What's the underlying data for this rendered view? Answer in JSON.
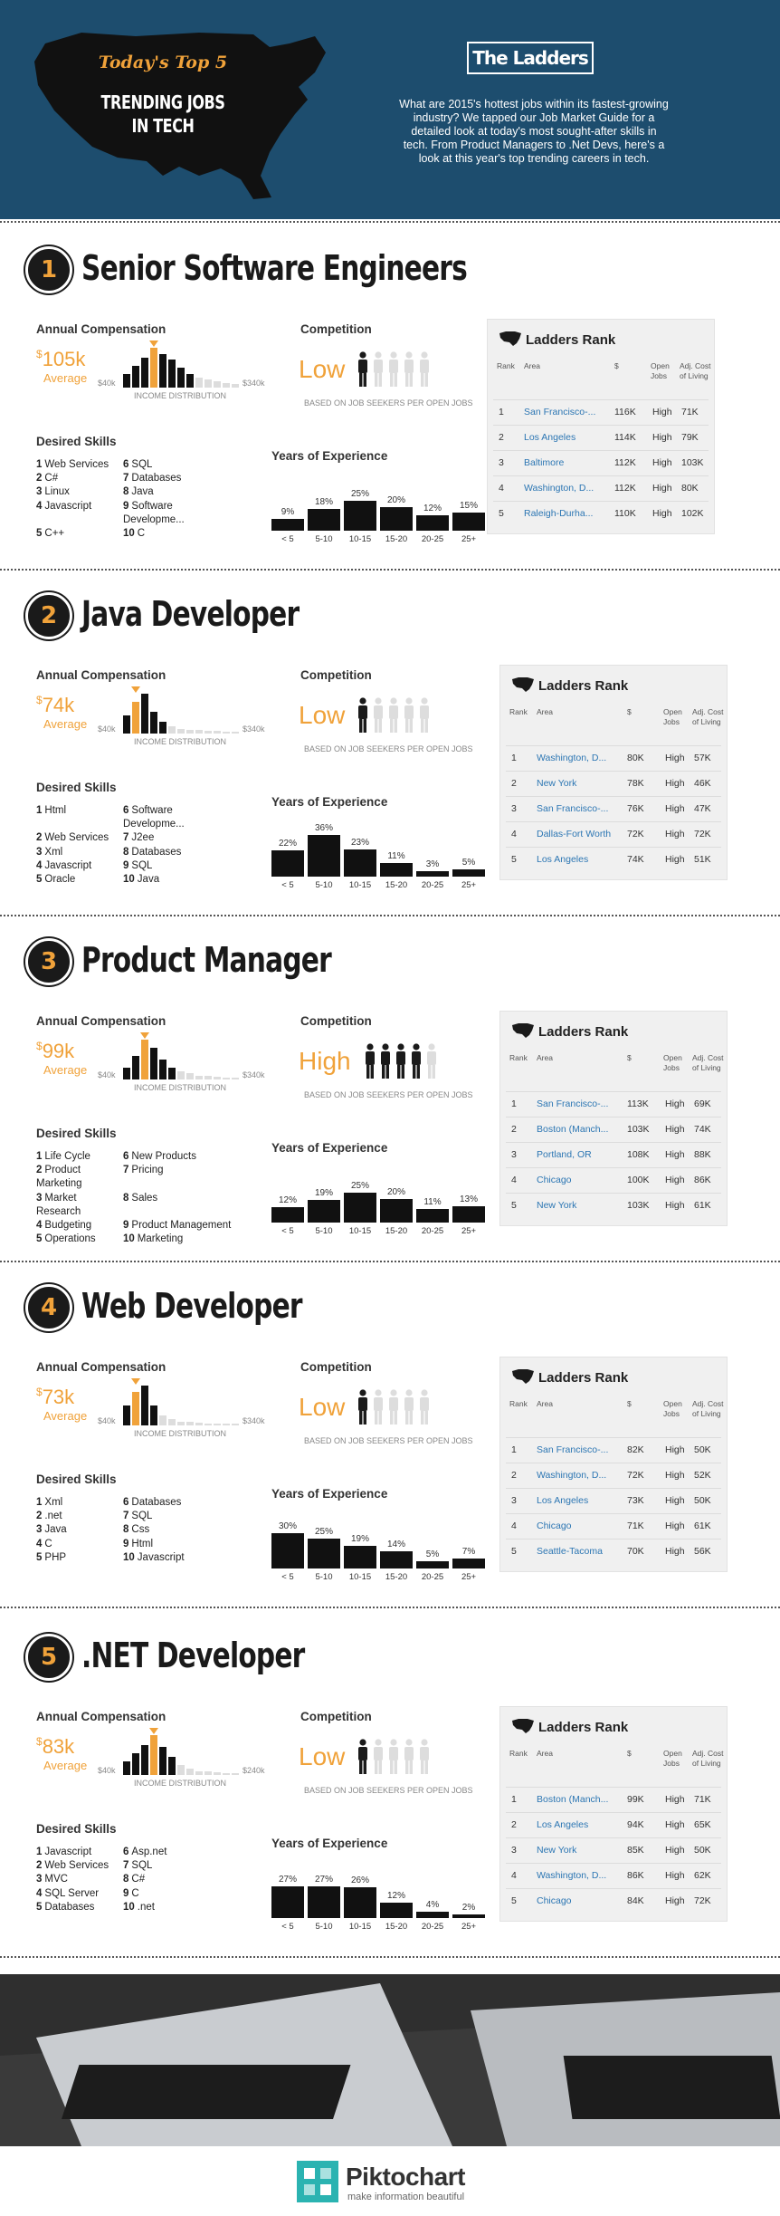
{
  "header": {
    "title_line1": "Today's Top 5",
    "title_line2": "TRENDING JOBS",
    "title_line3": "IN TECH",
    "brand": "The Ladders",
    "intro": "What are 2015's hottest jobs within its fastest-growing industry? We tapped our Job Market Guide for a detailed look at today's most sought-after skills in tech. From Product Managers to .Net Devs, here's a look at this year's top trending careers in tech."
  },
  "labels": {
    "annual_compensation": "Annual Compensation",
    "average": "Average",
    "income_distribution": "INCOME DISTRIBUTION",
    "competition": "Competition",
    "competition_basis": "BASED ON JOB SEEKERS PER OPEN JOBS",
    "desired_skills": "Desired Skills",
    "years_experience": "Years of Experience",
    "ladders_rank": "Ladders Rank",
    "col_rank": "Rank",
    "col_area": "Area",
    "col_salary": "$",
    "col_open_jobs": "Open Jobs",
    "col_cost": "Adj. Cost of Living"
  },
  "jobs": [
    {
      "number": "1",
      "title": "Senior Software Engineers",
      "comp_value": "105k",
      "dist_min": "$40k",
      "dist_max": "$340k",
      "dist_highlight": 3,
      "dist_bars": [
        0.35,
        0.55,
        0.75,
        1.0,
        0.85,
        0.7,
        0.5,
        0.35,
        0.25,
        0.2,
        0.15,
        0.12,
        0.1
      ],
      "competition_level": "Low",
      "competition_filled": 1,
      "skills": [
        {
          "n": "1",
          "s": "Web Services"
        },
        {
          "n": "6",
          "s": "SQL"
        },
        {
          "n": "2",
          "s": "C#"
        },
        {
          "n": "7",
          "s": "Databases"
        },
        {
          "n": "3",
          "s": "Linux"
        },
        {
          "n": "8",
          "s": "Java"
        },
        {
          "n": "4",
          "s": "Javascript"
        },
        {
          "n": "9",
          "s": "Software Developme..."
        },
        {
          "n": "5",
          "s": "C++"
        },
        {
          "n": "10",
          "s": "C"
        }
      ],
      "experience": [
        {
          "cat": "< 5",
          "pct": "9%",
          "val": 9
        },
        {
          "cat": "5-10",
          "pct": "18%",
          "val": 18
        },
        {
          "cat": "10-15",
          "pct": "25%",
          "val": 25
        },
        {
          "cat": "15-20",
          "pct": "20%",
          "val": 20
        },
        {
          "cat": "20-25",
          "pct": "12%",
          "val": 12
        },
        {
          "cat": "25+",
          "pct": "15%",
          "val": 15
        }
      ],
      "rank": [
        {
          "r": "1",
          "area": "San Francisco-...",
          "sal": "116K",
          "jobs": "High",
          "col": "71K"
        },
        {
          "r": "2",
          "area": "Los Angeles",
          "sal": "114K",
          "jobs": "High",
          "col": "79K"
        },
        {
          "r": "3",
          "area": "Baltimore",
          "sal": "112K",
          "jobs": "High",
          "col": "103K"
        },
        {
          "r": "4",
          "area": "Washington, D...",
          "sal": "112K",
          "jobs": "High",
          "col": "80K"
        },
        {
          "r": "5",
          "area": "Raleigh-Durha...",
          "sal": "110K",
          "jobs": "High",
          "col": "102K"
        }
      ]
    },
    {
      "number": "2",
      "title": "Java Developer",
      "comp_value": "74k",
      "dist_min": "$40k",
      "dist_max": "$340k",
      "dist_highlight": 1,
      "dist_bars": [
        0.45,
        0.8,
        1.0,
        0.55,
        0.3,
        0.18,
        0.12,
        0.1,
        0.08,
        0.07,
        0.06,
        0.05,
        0.05
      ],
      "competition_level": "Low",
      "competition_filled": 1,
      "skills": [
        {
          "n": "1",
          "s": "Html"
        },
        {
          "n": "6",
          "s": "Software Developme..."
        },
        {
          "n": "2",
          "s": "Web Services"
        },
        {
          "n": "7",
          "s": "J2ee"
        },
        {
          "n": "3",
          "s": "Xml"
        },
        {
          "n": "8",
          "s": "Databases"
        },
        {
          "n": "4",
          "s": "Javascript"
        },
        {
          "n": "9",
          "s": "SQL"
        },
        {
          "n": "5",
          "s": "Oracle"
        },
        {
          "n": "10",
          "s": "Java"
        }
      ],
      "experience": [
        {
          "cat": "< 5",
          "pct": "22%",
          "val": 22
        },
        {
          "cat": "5-10",
          "pct": "36%",
          "val": 36
        },
        {
          "cat": "10-15",
          "pct": "23%",
          "val": 23
        },
        {
          "cat": "15-20",
          "pct": "11%",
          "val": 11
        },
        {
          "cat": "20-25",
          "pct": "3%",
          "val": 3
        },
        {
          "cat": "25+",
          "pct": "5%",
          "val": 5
        }
      ],
      "rank": [
        {
          "r": "1",
          "area": "Washington, D...",
          "sal": "80K",
          "jobs": "High",
          "col": "57K"
        },
        {
          "r": "2",
          "area": "New York",
          "sal": "78K",
          "jobs": "High",
          "col": "46K"
        },
        {
          "r": "3",
          "area": "San Francisco-...",
          "sal": "76K",
          "jobs": "High",
          "col": "47K"
        },
        {
          "r": "4",
          "area": "Dallas-Fort Worth",
          "sal": "72K",
          "jobs": "High",
          "col": "72K"
        },
        {
          "r": "5",
          "area": "Los Angeles",
          "sal": "74K",
          "jobs": "High",
          "col": "51K"
        }
      ]
    },
    {
      "number": "3",
      "title": "Product Manager",
      "comp_value": "99k",
      "dist_min": "$40k",
      "dist_max": "$340k",
      "dist_highlight": 2,
      "dist_bars": [
        0.3,
        0.6,
        1.0,
        0.8,
        0.5,
        0.3,
        0.2,
        0.15,
        0.1,
        0.08,
        0.06,
        0.05,
        0.05
      ],
      "competition_level": "High",
      "competition_filled": 4,
      "skills": [
        {
          "n": "1",
          "s": "Life Cycle"
        },
        {
          "n": "6",
          "s": "New Products"
        },
        {
          "n": "2",
          "s": "Product Marketing"
        },
        {
          "n": "7",
          "s": "Pricing"
        },
        {
          "n": "3",
          "s": "Market Research"
        },
        {
          "n": "8",
          "s": "Sales"
        },
        {
          "n": "4",
          "s": "Budgeting"
        },
        {
          "n": "9",
          "s": "Product Management"
        },
        {
          "n": "5",
          "s": "Operations"
        },
        {
          "n": "10",
          "s": "Marketing"
        }
      ],
      "experience": [
        {
          "cat": "< 5",
          "pct": "12%",
          "val": 12
        },
        {
          "cat": "5-10",
          "pct": "19%",
          "val": 19
        },
        {
          "cat": "10-15",
          "pct": "25%",
          "val": 25
        },
        {
          "cat": "15-20",
          "pct": "20%",
          "val": 20
        },
        {
          "cat": "20-25",
          "pct": "11%",
          "val": 11
        },
        {
          "cat": "25+",
          "pct": "13%",
          "val": 13
        }
      ],
      "rank": [
        {
          "r": "1",
          "area": "San Francisco-...",
          "sal": "113K",
          "jobs": "High",
          "col": "69K"
        },
        {
          "r": "2",
          "area": "Boston (Manch...",
          "sal": "103K",
          "jobs": "High",
          "col": "74K"
        },
        {
          "r": "3",
          "area": "Portland, OR",
          "sal": "108K",
          "jobs": "High",
          "col": "88K"
        },
        {
          "r": "4",
          "area": "Chicago",
          "sal": "100K",
          "jobs": "High",
          "col": "86K"
        },
        {
          "r": "5",
          "area": "New York",
          "sal": "103K",
          "jobs": "High",
          "col": "61K"
        }
      ]
    },
    {
      "number": "4",
      "title": "Web Developer",
      "comp_value": "73k",
      "dist_min": "$40k",
      "dist_max": "$340k",
      "dist_highlight": 1,
      "dist_bars": [
        0.5,
        0.85,
        1.0,
        0.5,
        0.25,
        0.15,
        0.1,
        0.08,
        0.06,
        0.05,
        0.05,
        0.04,
        0.04
      ],
      "competition_level": "Low",
      "competition_filled": 1,
      "skills": [
        {
          "n": "1",
          "s": "Xml"
        },
        {
          "n": "6",
          "s": "Databases"
        },
        {
          "n": "2",
          "s": ".net"
        },
        {
          "n": "7",
          "s": "SQL"
        },
        {
          "n": "3",
          "s": "Java"
        },
        {
          "n": "8",
          "s": "Css"
        },
        {
          "n": "4",
          "s": "C"
        },
        {
          "n": "9",
          "s": "Html"
        },
        {
          "n": "5",
          "s": "PHP"
        },
        {
          "n": "10",
          "s": "Javascript"
        }
      ],
      "experience": [
        {
          "cat": "< 5",
          "pct": "30%",
          "val": 30
        },
        {
          "cat": "5-10",
          "pct": "25%",
          "val": 25
        },
        {
          "cat": "10-15",
          "pct": "19%",
          "val": 19
        },
        {
          "cat": "15-20",
          "pct": "14%",
          "val": 14
        },
        {
          "cat": "20-25",
          "pct": "5%",
          "val": 5
        },
        {
          "cat": "25+",
          "pct": "7%",
          "val": 7
        }
      ],
      "rank": [
        {
          "r": "1",
          "area": "San Francisco-...",
          "sal": "82K",
          "jobs": "High",
          "col": "50K"
        },
        {
          "r": "2",
          "area": "Washington, D...",
          "sal": "72K",
          "jobs": "High",
          "col": "52K"
        },
        {
          "r": "3",
          "area": "Los Angeles",
          "sal": "73K",
          "jobs": "High",
          "col": "50K"
        },
        {
          "r": "4",
          "area": "Chicago",
          "sal": "71K",
          "jobs": "High",
          "col": "61K"
        },
        {
          "r": "5",
          "area": "Seattle-Tacoma",
          "sal": "70K",
          "jobs": "High",
          "col": "56K"
        }
      ]
    },
    {
      "number": "5",
      "title": ".NET Developer",
      "comp_value": "83k",
      "dist_min": "$40k",
      "dist_max": "$240k",
      "dist_highlight": 3,
      "dist_bars": [
        0.35,
        0.55,
        0.75,
        1.0,
        0.7,
        0.45,
        0.25,
        0.15,
        0.1,
        0.08,
        0.06,
        0.05,
        0.05
      ],
      "competition_level": "Low",
      "competition_filled": 1,
      "skills": [
        {
          "n": "1",
          "s": "Javascript"
        },
        {
          "n": "6",
          "s": "Asp.net"
        },
        {
          "n": "2",
          "s": "Web Services"
        },
        {
          "n": "7",
          "s": "SQL"
        },
        {
          "n": "3",
          "s": "MVC"
        },
        {
          "n": "8",
          "s": "C#"
        },
        {
          "n": "4",
          "s": "SQL Server"
        },
        {
          "n": "9",
          "s": "C"
        },
        {
          "n": "5",
          "s": "Databases"
        },
        {
          "n": "10",
          "s": ".net"
        }
      ],
      "experience": [
        {
          "cat": "< 5",
          "pct": "27%",
          "val": 27
        },
        {
          "cat": "5-10",
          "pct": "27%",
          "val": 27
        },
        {
          "cat": "10-15",
          "pct": "26%",
          "val": 26
        },
        {
          "cat": "15-20",
          "pct": "12%",
          "val": 12
        },
        {
          "cat": "20-25",
          "pct": "4%",
          "val": 4
        },
        {
          "cat": "25+",
          "pct": "2%",
          "val": 2
        }
      ],
      "rank": [
        {
          "r": "1",
          "area": "Boston (Manch...",
          "sal": "99K",
          "jobs": "High",
          "col": "71K"
        },
        {
          "r": "2",
          "area": "Los Angeles",
          "sal": "94K",
          "jobs": "High",
          "col": "65K"
        },
        {
          "r": "3",
          "area": "New York",
          "sal": "85K",
          "jobs": "High",
          "col": "50K"
        },
        {
          "r": "4",
          "area": "Washington, D...",
          "sal": "86K",
          "jobs": "High",
          "col": "62K"
        },
        {
          "r": "5",
          "area": "Chicago",
          "sal": "84K",
          "jobs": "High",
          "col": "72K"
        }
      ]
    }
  ],
  "footer": {
    "brand": "Piktochart",
    "tagline": "make information beautiful"
  },
  "colors": {
    "accent": "#f0a23a",
    "header_bg": "#1d4d6e",
    "link": "#2c76b3"
  }
}
